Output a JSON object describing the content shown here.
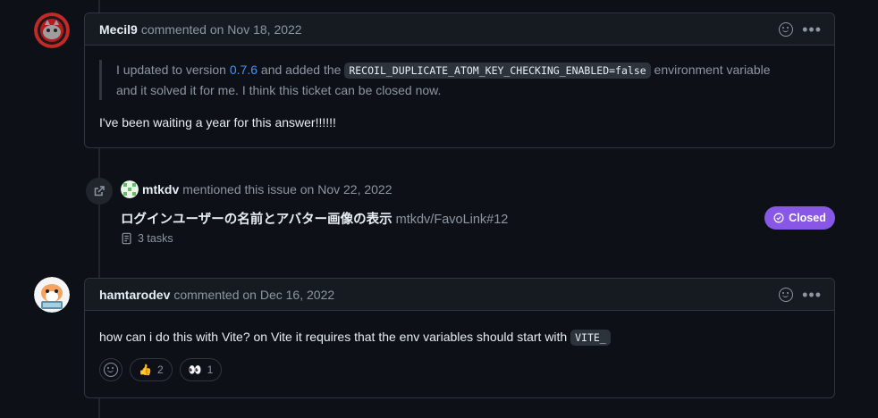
{
  "comment1": {
    "author": "Mecil9",
    "meta": "commented on Nov 18, 2022",
    "quote_part1": "I updated to version ",
    "quote_link": "0.7.6",
    "quote_part2": " and added the ",
    "quote_code": "RECOIL_DUPLICATE_ATOM_KEY_CHECKING_ENABLED=false",
    "quote_part3": " environment variable",
    "quote_part4": "and it solved it for me. I think this ticket can be closed now.",
    "body": "I've been waiting a year for this answer!!!!!!"
  },
  "mention_event": {
    "user": "mtkdv",
    "meta": "mentioned this issue on Nov 22, 2022",
    "issue_title": "ログインユーザーの名前とアバター画像の表示",
    "issue_ref": "mtkdv/FavoLink#12",
    "tasks": "3 tasks",
    "status": "Closed"
  },
  "comment2": {
    "author": "hamtarodev",
    "meta": "commented on Dec 16, 2022",
    "body_text": "how can i do this with Vite? on Vite it requires that the env variables should start with ",
    "body_code": "VITE_",
    "reactions": [
      {
        "emoji": "👍",
        "count": "2"
      },
      {
        "emoji": "👀",
        "count": "1"
      }
    ]
  },
  "colors": {
    "background": "#0d1117",
    "link": "#4493f8",
    "closed_badge": "#8957e5",
    "border": "#30363d"
  }
}
